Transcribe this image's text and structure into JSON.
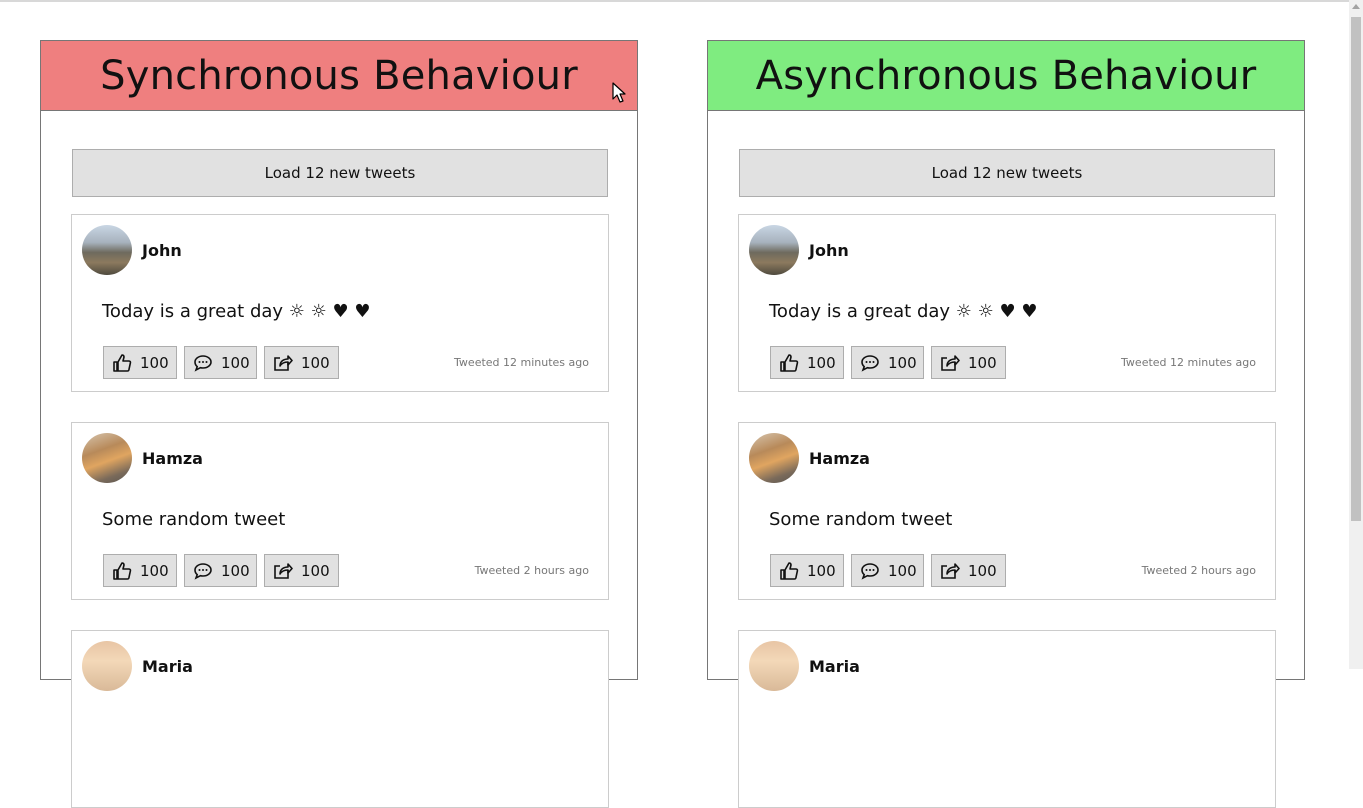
{
  "panels": {
    "sync": {
      "title": "Synchronous Behaviour",
      "load_button": "Load 12 new tweets",
      "color": "#ef7f7f"
    },
    "async": {
      "title": "Asynchronous Behaviour",
      "load_button": "Load 12 new tweets",
      "color": "#7fec80"
    }
  },
  "tweets": [
    {
      "author": "John",
      "text": "Today is a great day ☼ ☼ ♥ ♥",
      "likes": "100",
      "comments": "100",
      "shares": "100",
      "time": "Tweeted 12 minutes ago"
    },
    {
      "author": "Hamza",
      "text": "Some random tweet",
      "likes": "100",
      "comments": "100",
      "shares": "100",
      "time": "Tweeted 2 hours ago"
    },
    {
      "author": "Maria"
    }
  ],
  "icons": {
    "like": "thumbs-up-icon",
    "comment": "comment-icon",
    "share": "share-icon"
  }
}
